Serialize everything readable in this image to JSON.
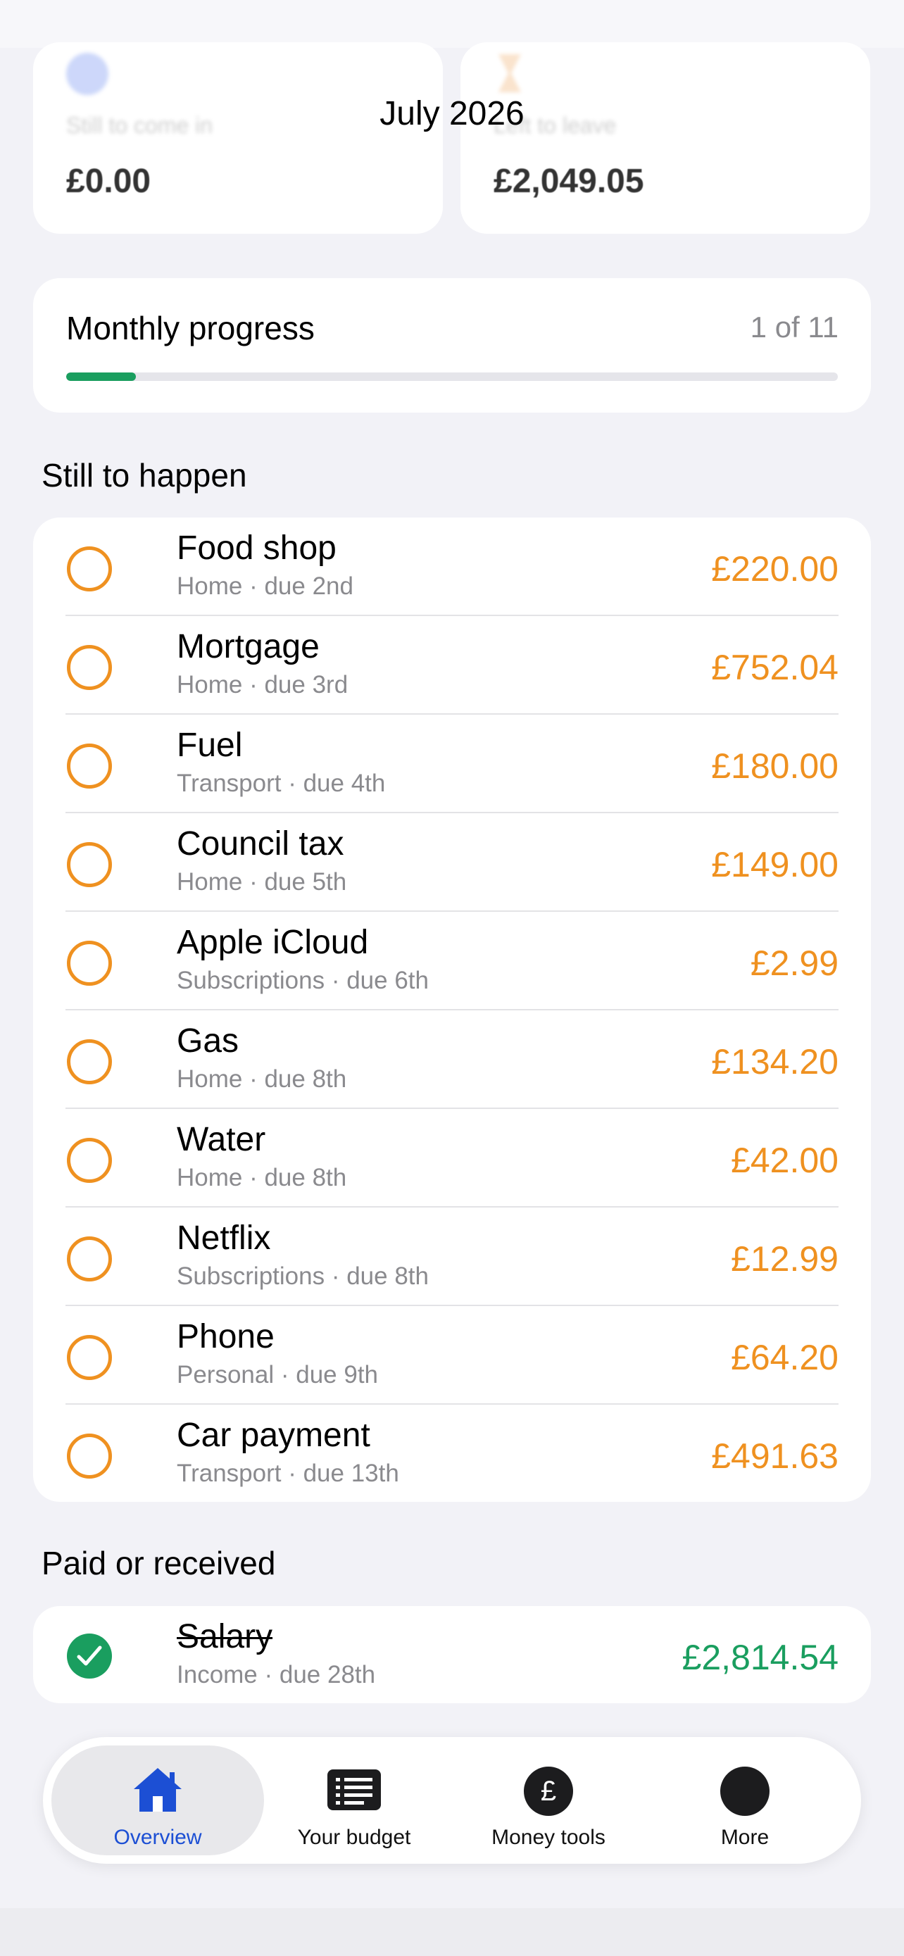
{
  "header": {
    "month": "July 2026"
  },
  "summary": {
    "left": {
      "label": "Still to come in",
      "value": "£0.00",
      "icon": "clock-icon"
    },
    "right": {
      "label": "Left to leave",
      "value": "£2,049.05",
      "icon": "hourglass-icon"
    }
  },
  "progress": {
    "title": "Monthly progress",
    "count": "1 of 11",
    "fraction": 0.09,
    "color": "#1a9e5f"
  },
  "still_to_happen": {
    "title": "Still to happen",
    "items": [
      {
        "name": "Food shop",
        "meta": "Home · due 2nd",
        "amount": "£220.00"
      },
      {
        "name": "Mortgage",
        "meta": "Home · due 3rd",
        "amount": "£752.04"
      },
      {
        "name": "Fuel",
        "meta": "Transport · due 4th",
        "amount": "£180.00"
      },
      {
        "name": "Council tax",
        "meta": "Home · due 5th",
        "amount": "£149.00"
      },
      {
        "name": "Apple iCloud",
        "meta": "Subscriptions · due 6th",
        "amount": "£2.99"
      },
      {
        "name": "Gas",
        "meta": "Home · due 8th",
        "amount": "£134.20"
      },
      {
        "name": "Water",
        "meta": "Home · due 8th",
        "amount": "£42.00"
      },
      {
        "name": "Netflix",
        "meta": "Subscriptions · due 8th",
        "amount": "£12.99"
      },
      {
        "name": "Phone",
        "meta": "Personal · due 9th",
        "amount": "£64.20"
      },
      {
        "name": "Car payment",
        "meta": "Transport · due 13th",
        "amount": "£491.63"
      }
    ]
  },
  "paid": {
    "title": "Paid or received",
    "items": [
      {
        "name": "Salary",
        "meta": "Income · due 28th",
        "amount": "£2,814.54"
      }
    ]
  },
  "tabs": [
    {
      "label": "Overview",
      "icon": "home-icon",
      "active": true
    },
    {
      "label": "Your budget",
      "icon": "list-icon",
      "active": false
    },
    {
      "label": "Money tools",
      "icon": "pound-icon",
      "active": false
    },
    {
      "label": "More",
      "icon": "more-icon",
      "active": false
    }
  ],
  "colors": {
    "pending": "#ef9120",
    "paid": "#1a9e5f",
    "accent": "#1c4fd4"
  }
}
